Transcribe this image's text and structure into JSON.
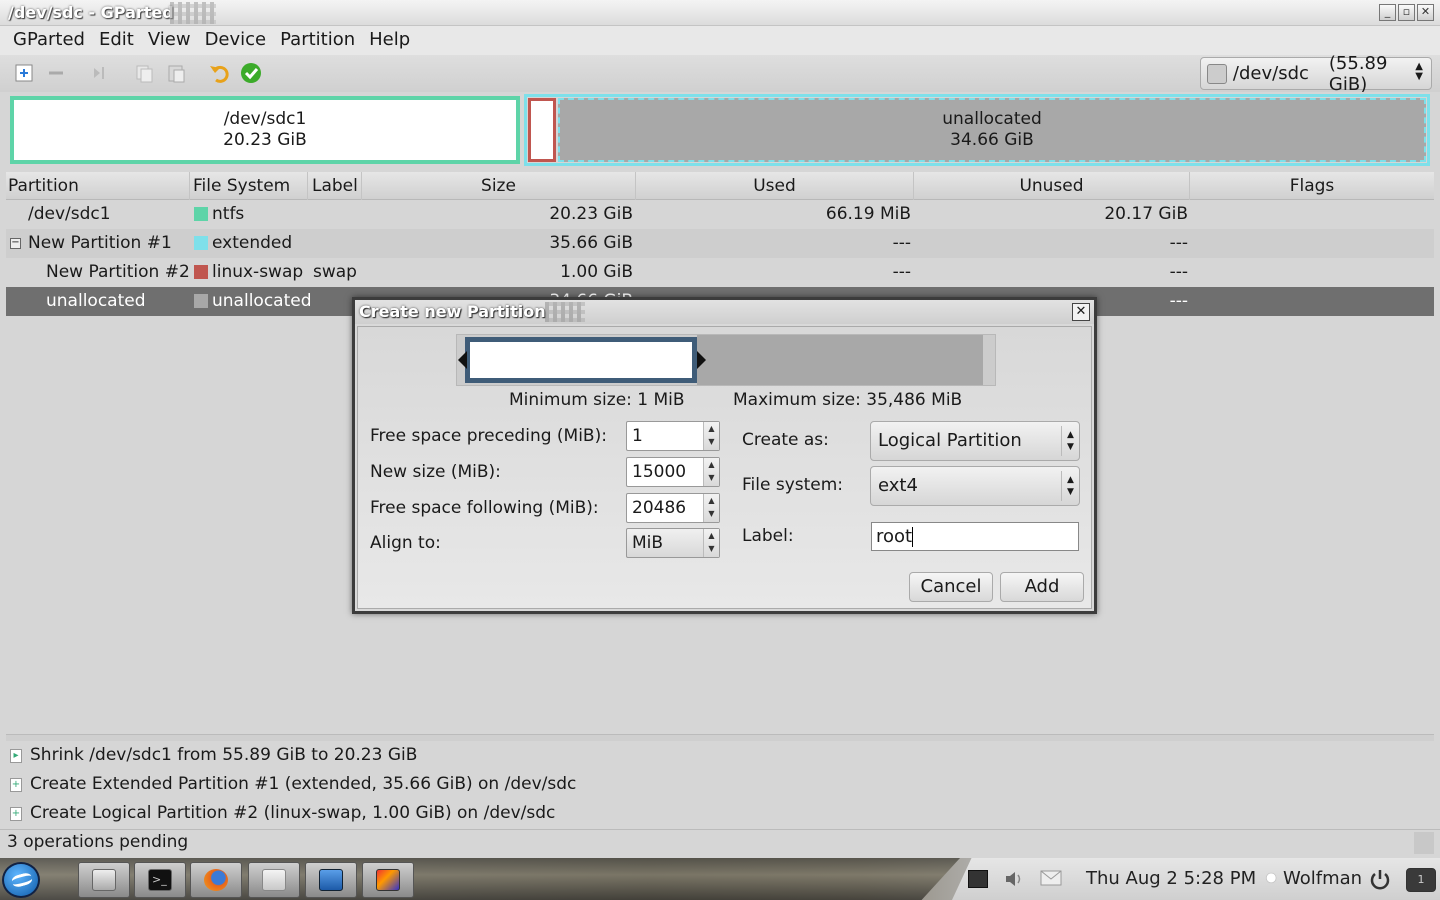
{
  "window": {
    "title": "/dev/sdc - GParted",
    "buttons": [
      "minimize",
      "maximize",
      "close"
    ]
  },
  "menubar": [
    "GParted",
    "Edit",
    "View",
    "Device",
    "Partition",
    "Help"
  ],
  "toolbar": {
    "icons": [
      "new-partition-icon",
      "delete-icon",
      "resize-move-icon",
      "copy-icon",
      "paste-icon",
      "undo-icon",
      "apply-icon"
    ],
    "device": {
      "name": "/dev/sdc",
      "size": "(55.89 GiB)"
    }
  },
  "diskmap": {
    "sdc1": {
      "name": "/dev/sdc1",
      "size": "20.23 GiB"
    },
    "unallocated": {
      "name": "unallocated",
      "size": "34.66 GiB"
    }
  },
  "table": {
    "headers": [
      "Partition",
      "File System",
      "Label",
      "Size",
      "Used",
      "Unused",
      "Flags"
    ],
    "rows": [
      {
        "partition": "/dev/sdc1",
        "fs": "ntfs",
        "fs_color": "#5ed4a8",
        "label": "",
        "size": "20.23 GiB",
        "used": "66.19 MiB",
        "unused": "20.17 GiB",
        "flags": ""
      },
      {
        "partition": "New Partition #1",
        "fs": "extended",
        "fs_color": "#7ee0ea",
        "label": "",
        "size": "35.66 GiB",
        "used": "---",
        "unused": "---",
        "flags": ""
      },
      {
        "partition": "New Partition #2",
        "fs": "linux-swap",
        "fs_color": "#c0564f",
        "label": "swap",
        "size": "1.00 GiB",
        "used": "---",
        "unused": "---",
        "flags": ""
      },
      {
        "partition": "unallocated",
        "fs": "unallocated",
        "fs_color": "#a8a8a8",
        "label": "",
        "size": "34.66 GiB",
        "used": "---",
        "unused": "---",
        "flags": ""
      }
    ]
  },
  "dialog": {
    "title": "Create new Partition",
    "min_size": "Minimum size: 1 MiB",
    "max_size": "Maximum size: 35,486 MiB",
    "fields": {
      "free_preceding": {
        "label": "Free space preceding (MiB):",
        "value": "1"
      },
      "new_size": {
        "label": "New size (MiB):",
        "value": "15000"
      },
      "free_following": {
        "label": "Free space following (MiB):",
        "value": "20486"
      },
      "align": {
        "label": "Align to:",
        "value": "MiB"
      }
    },
    "create_as": {
      "label": "Create as:",
      "value": "Logical Partition"
    },
    "file_system": {
      "label": "File system:",
      "value": "ext4"
    },
    "part_label": {
      "label": "Label:",
      "value": "root"
    },
    "cancel": "Cancel",
    "add": "Add"
  },
  "operations": [
    "Shrink /dev/sdc1 from 55.89 GiB to 20.23 GiB",
    "Create Extended Partition #1 (extended, 35.66 GiB) on /dev/sdc",
    "Create Logical Partition #2 (linux-swap, 1.00 GiB) on /dev/sdc"
  ],
  "status": "3 operations pending",
  "taskbar": {
    "clock": "Thu Aug  2  5:28 PM",
    "user": "Wolfman",
    "pager": "1"
  }
}
